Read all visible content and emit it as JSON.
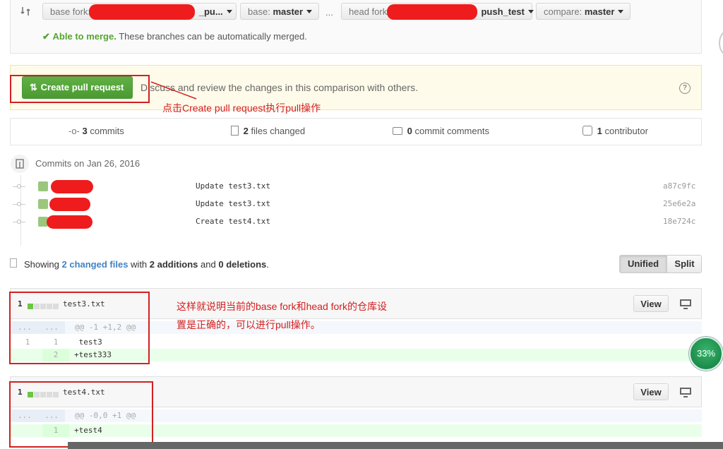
{
  "compare_bar": {
    "base_fork": {
      "label": "base fork:",
      "value": "_pu..."
    },
    "base": {
      "label": "base:",
      "value": "master"
    },
    "ellipsis": "...",
    "head_fork": {
      "label": "head fork:",
      "value": "push_test"
    },
    "compare": {
      "label": "compare:",
      "value": "master"
    },
    "merge_status": {
      "bold": "Able to merge.",
      "text": "These branches can be automatically merged."
    }
  },
  "pr_box": {
    "button_label": "Create pull request",
    "description": "Discuss and review the changes in this comparison with others."
  },
  "annotations": {
    "create_pr": "点击Create pull request执行pull操作",
    "fork_line1": "这样就说明当前的base fork和head fork的仓库设",
    "fork_line2": "置是正确的，可以进行pull操作。"
  },
  "stats": {
    "commits": {
      "count": "3",
      "label": "commits"
    },
    "files": {
      "count": "2",
      "label": "files changed"
    },
    "comments": {
      "count": "0",
      "label": "commit comments"
    },
    "contributors": {
      "count": "1",
      "label": "contributor"
    }
  },
  "commits_header": "Commits on Jan 26, 2016",
  "commits": [
    {
      "message": "Update test3.txt",
      "sha": "a87c9fc"
    },
    {
      "message": "Update test3.txt",
      "sha": "25e6e2a"
    },
    {
      "message": "Create test4.txt",
      "sha": "18e724c"
    }
  ],
  "summary": {
    "showing": "Showing",
    "changed": "2 changed files",
    "with": "with",
    "additions": "2 additions",
    "and": "and",
    "deletions": "0 deletions",
    "period": "."
  },
  "view_toggle": {
    "unified": "Unified",
    "split": "Split"
  },
  "files": [
    {
      "count": "1",
      "name": "test3.txt",
      "view_label": "View",
      "hunk": {
        "old": "...",
        "new": "...",
        "header": "@@ -1 +1,2 @@"
      },
      "lines": [
        {
          "old": "1",
          "new": "1",
          "text": " test3"
        },
        {
          "old": "",
          "new": "2",
          "text": "+test333"
        }
      ]
    },
    {
      "count": "1",
      "name": "test4.txt",
      "view_label": "View",
      "hunk": {
        "old": "...",
        "new": "...",
        "header": "@@ -0,0 +1 @@"
      },
      "lines": [
        {
          "old": "",
          "new": "1",
          "text": "+test4"
        }
      ]
    }
  ],
  "progress_badge": {
    "value": "33%"
  },
  "colors": {
    "green": "#55a532",
    "red_annotation": "#d32020",
    "addition_bg": "#eaffea",
    "link_blue": "#4183c4"
  }
}
